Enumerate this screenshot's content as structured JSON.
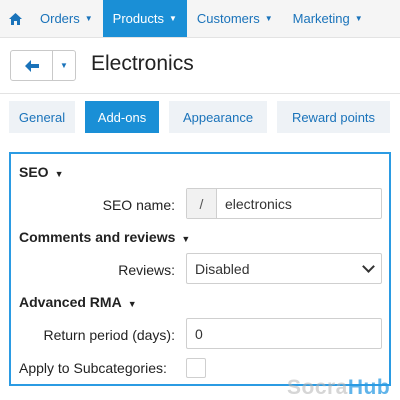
{
  "topnav": {
    "home_icon": "home-icon",
    "items": [
      {
        "label": "Orders",
        "active": false
      },
      {
        "label": "Products",
        "active": true
      },
      {
        "label": "Customers",
        "active": false
      },
      {
        "label": "Marketing",
        "active": false
      }
    ],
    "caret": "▼"
  },
  "titlebar": {
    "back_icon": "arrow-left-icon",
    "dropdown_icon": "chevron-down-icon",
    "title": "Electronics"
  },
  "tabs": [
    {
      "label": "General",
      "active": false
    },
    {
      "label": "Add-ons",
      "active": true
    },
    {
      "label": "Appearance",
      "active": false
    },
    {
      "label": "Reward points",
      "active": false
    }
  ],
  "form": {
    "seo": {
      "title": "SEO",
      "seo_name_label": "SEO name:",
      "seo_name_prefix": "/",
      "seo_name_value": "electronics"
    },
    "comments": {
      "title": "Comments and reviews",
      "reviews_label": "Reviews:",
      "reviews_value": "Disabled"
    },
    "rma": {
      "title": "Advanced RMA",
      "return_period_label": "Return period (days):",
      "return_period_value": "0",
      "apply_label": "Apply to Subcategories:",
      "apply_checked": false
    }
  },
  "watermark": {
    "part1": "Socra",
    "part2": "Hub"
  },
  "colors": {
    "accent": "#1a8fd6",
    "link": "#1a73ba",
    "panel_border": "#2b9be3"
  }
}
